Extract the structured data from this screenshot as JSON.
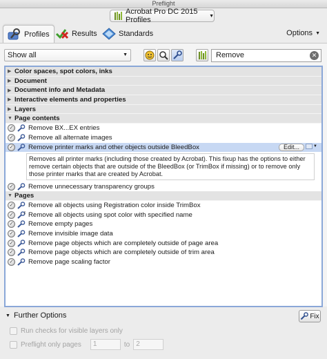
{
  "window": {
    "title": "Preflight"
  },
  "profile": {
    "selected": "Acrobat Pro DC 2015 Profiles"
  },
  "tabs": [
    {
      "label": "Profiles"
    },
    {
      "label": "Results"
    },
    {
      "label": "Standards"
    }
  ],
  "options_label": "Options",
  "filter": {
    "selected": "Show all"
  },
  "search": {
    "value": "Remove"
  },
  "categories": {
    "color_spaces": "Color spaces, spot colors, inks",
    "document": "Document",
    "doc_info": "Document info and Metadata",
    "interactive": "Interactive elements and properties",
    "layers": "Layers",
    "page_contents": "Page contents",
    "pages": "Pages"
  },
  "page_contents_items": {
    "i0": "Remove BX...EX entries",
    "i1": "Remove all alternate images",
    "i2": "Remove printer marks and other objects outside BleedBox",
    "i3": "Remove unnecessary transparency groups"
  },
  "edit_label": "Edit...",
  "description": "Removes all printer marks (including those created by Acrobat). This fixup has the options to either remove certain objects that are outside of the BleedBox (or TrimBox if missing) or to remove only those printer marks that are created by Acrobat.",
  "pages_items": [
    "Remove all objects using Registration color inside TrimBox",
    "Remove all objects using spot color with specified name",
    "Remove empty pages",
    "Remove invisible image data",
    "Remove page objects which are completely outside of page area",
    "Remove page objects which are completely outside of trim area",
    "Remove page scaling factor"
  ],
  "further_options": "Further Options",
  "fix_label": "Fix",
  "run_checks_label": "Run checks for visible layers only",
  "preflight_pages_label": "Preflight only pages",
  "pages_from": "1",
  "to_label": "to",
  "pages_to": "2"
}
